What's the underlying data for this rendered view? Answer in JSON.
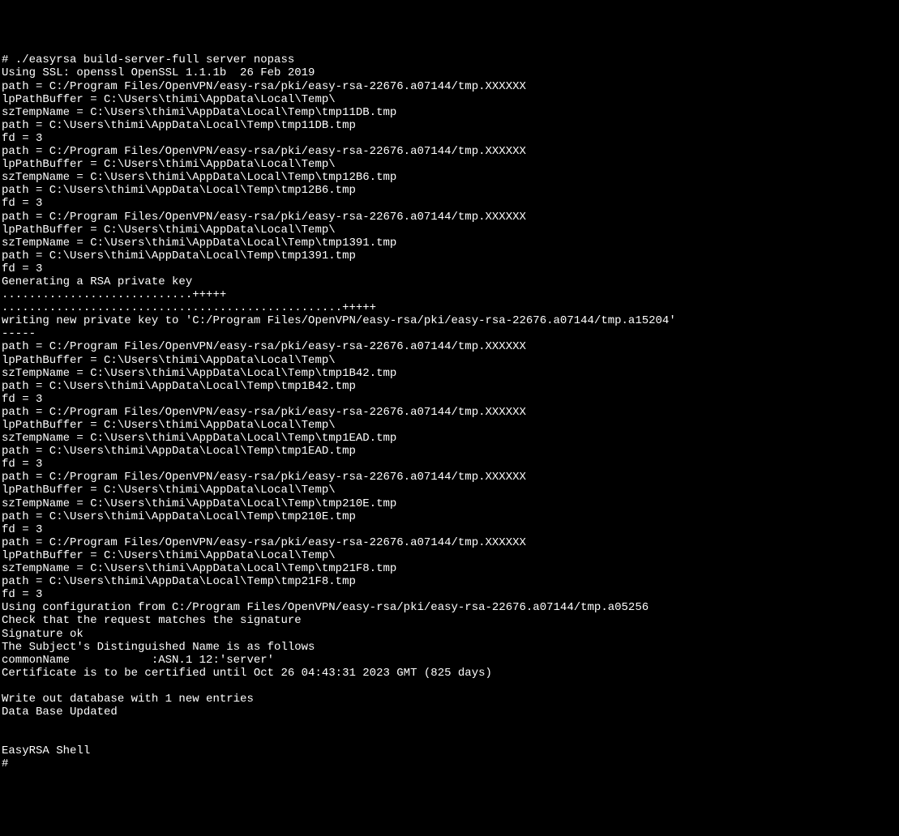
{
  "lines": [
    "# ./easyrsa build-server-full server nopass",
    "Using SSL: openssl OpenSSL 1.1.1b  26 Feb 2019",
    "path = C:/Program Files/OpenVPN/easy-rsa/pki/easy-rsa-22676.a07144/tmp.XXXXXX",
    "lpPathBuffer = C:\\Users\\thimi\\AppData\\Local\\Temp\\",
    "szTempName = C:\\Users\\thimi\\AppData\\Local\\Temp\\tmp11DB.tmp",
    "path = C:\\Users\\thimi\\AppData\\Local\\Temp\\tmp11DB.tmp",
    "fd = 3",
    "path = C:/Program Files/OpenVPN/easy-rsa/pki/easy-rsa-22676.a07144/tmp.XXXXXX",
    "lpPathBuffer = C:\\Users\\thimi\\AppData\\Local\\Temp\\",
    "szTempName = C:\\Users\\thimi\\AppData\\Local\\Temp\\tmp12B6.tmp",
    "path = C:\\Users\\thimi\\AppData\\Local\\Temp\\tmp12B6.tmp",
    "fd = 3",
    "path = C:/Program Files/OpenVPN/easy-rsa/pki/easy-rsa-22676.a07144/tmp.XXXXXX",
    "lpPathBuffer = C:\\Users\\thimi\\AppData\\Local\\Temp\\",
    "szTempName = C:\\Users\\thimi\\AppData\\Local\\Temp\\tmp1391.tmp",
    "path = C:\\Users\\thimi\\AppData\\Local\\Temp\\tmp1391.tmp",
    "fd = 3",
    "Generating a RSA private key",
    "............................+++++",
    "..................................................+++++",
    "writing new private key to 'C:/Program Files/OpenVPN/easy-rsa/pki/easy-rsa-22676.a07144/tmp.a15204'",
    "-----",
    "path = C:/Program Files/OpenVPN/easy-rsa/pki/easy-rsa-22676.a07144/tmp.XXXXXX",
    "lpPathBuffer = C:\\Users\\thimi\\AppData\\Local\\Temp\\",
    "szTempName = C:\\Users\\thimi\\AppData\\Local\\Temp\\tmp1B42.tmp",
    "path = C:\\Users\\thimi\\AppData\\Local\\Temp\\tmp1B42.tmp",
    "fd = 3",
    "path = C:/Program Files/OpenVPN/easy-rsa/pki/easy-rsa-22676.a07144/tmp.XXXXXX",
    "lpPathBuffer = C:\\Users\\thimi\\AppData\\Local\\Temp\\",
    "szTempName = C:\\Users\\thimi\\AppData\\Local\\Temp\\tmp1EAD.tmp",
    "path = C:\\Users\\thimi\\AppData\\Local\\Temp\\tmp1EAD.tmp",
    "fd = 3",
    "path = C:/Program Files/OpenVPN/easy-rsa/pki/easy-rsa-22676.a07144/tmp.XXXXXX",
    "lpPathBuffer = C:\\Users\\thimi\\AppData\\Local\\Temp\\",
    "szTempName = C:\\Users\\thimi\\AppData\\Local\\Temp\\tmp210E.tmp",
    "path = C:\\Users\\thimi\\AppData\\Local\\Temp\\tmp210E.tmp",
    "fd = 3",
    "path = C:/Program Files/OpenVPN/easy-rsa/pki/easy-rsa-22676.a07144/tmp.XXXXXX",
    "lpPathBuffer = C:\\Users\\thimi\\AppData\\Local\\Temp\\",
    "szTempName = C:\\Users\\thimi\\AppData\\Local\\Temp\\tmp21F8.tmp",
    "path = C:\\Users\\thimi\\AppData\\Local\\Temp\\tmp21F8.tmp",
    "fd = 3",
    "Using configuration from C:/Program Files/OpenVPN/easy-rsa/pki/easy-rsa-22676.a07144/tmp.a05256",
    "Check that the request matches the signature",
    "Signature ok",
    "The Subject's Distinguished Name is as follows",
    "commonName            :ASN.1 12:'server'",
    "Certificate is to be certified until Oct 26 04:43:31 2023 GMT (825 days)",
    "",
    "Write out database with 1 new entries",
    "Data Base Updated",
    "",
    "",
    "EasyRSA Shell",
    "# "
  ]
}
